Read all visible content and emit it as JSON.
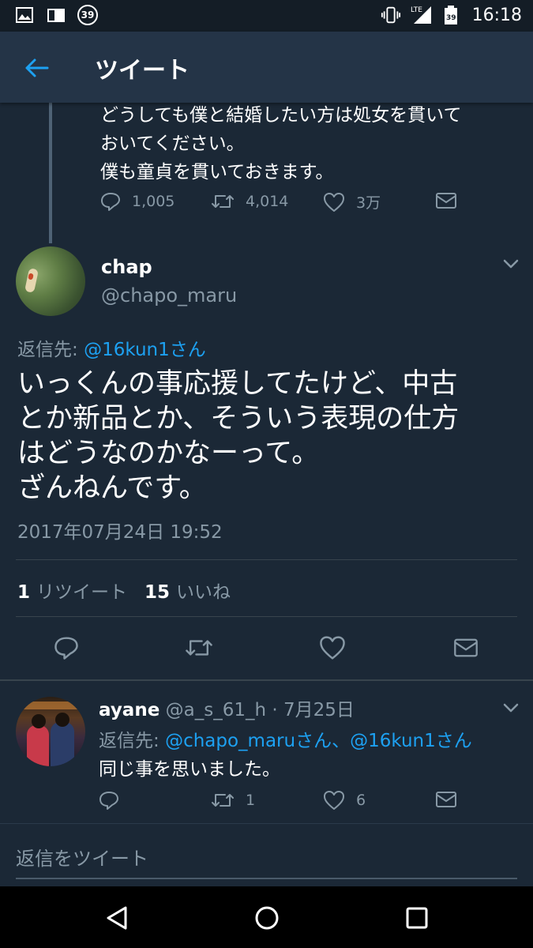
{
  "status_bar": {
    "notification_count": "39",
    "battery_label": "39",
    "network": "LTE",
    "time": "16:18"
  },
  "header": {
    "title": "ツイート"
  },
  "previous_tweet": {
    "text": "どうしても僕と結婚したい方は処女を貫いて\nおいてください。\n僕も童貞を貫いておきます。",
    "reply_count": "1,005",
    "retweet_count": "4,014",
    "like_count": "3万"
  },
  "main_tweet": {
    "display_name": "chap",
    "handle": "@chapo_maru",
    "reply_to_prefix": "返信先: ",
    "reply_to_handle": "@16kun1さん",
    "text": "いっくんの事応援してたけど、中古\nとか新品とか、そういう表現の仕方\nはどうなのかなーって。\nざんねんです。",
    "timestamp": "2017年07月24日 19:52",
    "retweets_count": "1",
    "retweets_label": "リツイート",
    "likes_count": "15",
    "likes_label": "いいね"
  },
  "reply_tweet": {
    "display_name": "ayane",
    "handle_date": "@a_s_61_h · 7月25日",
    "reply_to_prefix": "返信先: ",
    "reply_to_handles": "@chapo_maruさん、@16kun1さん",
    "text": "同じ事を思いました。",
    "retweet_count": "1",
    "like_count": "6"
  },
  "compose": {
    "placeholder": "返信をツイート"
  },
  "colors": {
    "background": "#1b2836",
    "header": "#243447",
    "link": "#1da1f2",
    "muted": "#8899a6"
  }
}
